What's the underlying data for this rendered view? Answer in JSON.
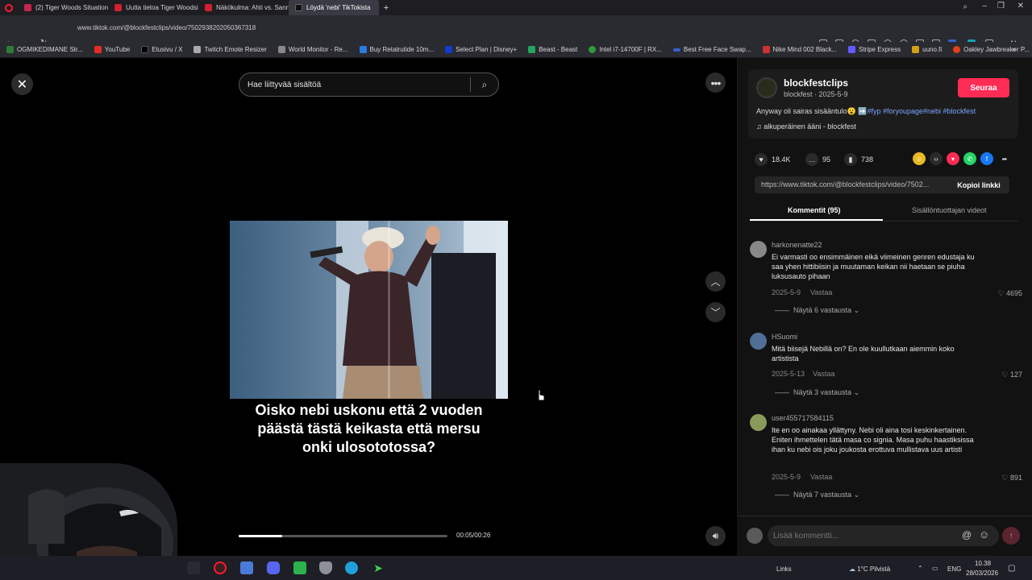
{
  "browser": {
    "tabs": [
      {
        "title": "(2) Tiger Woods Situation",
        "color": "#c7254e"
      },
      {
        "title": "Uutta tietoa Tiger Woodsi",
        "color": "#d3202e"
      },
      {
        "title": "Näkökulma: Ahti vs. Sann",
        "color": "#d3202e"
      },
      {
        "title": "Löydä 'nebi' TikTokista",
        "color": "#222"
      }
    ],
    "url": "www.tiktok.com/@blockfestclips/video/7502938202050367318",
    "bookmarks": [
      {
        "label": "OGMIKEDIMANE Str...",
        "color": "#2e7d32"
      },
      {
        "label": "YouTube",
        "color": "#e52d27"
      },
      {
        "label": "Etusivu / X",
        "color": "#000"
      },
      {
        "label": "Twitch Emote Resizer",
        "color": "#aaa"
      },
      {
        "label": "World Monitor - Re...",
        "color": "#888"
      },
      {
        "label": "Buy Retatrutide 10m...",
        "color": "#2a7ae2"
      },
      {
        "label": "Select Plan | Disney+",
        "color": "#113ccf"
      },
      {
        "label": "Beast - Beast",
        "color": "#25a55f"
      },
      {
        "label": "Intel i7-14700F | RX...",
        "color": "#2e9a3b"
      },
      {
        "label": "Best Free Face Swap...",
        "color": "#3a5fcf"
      },
      {
        "label": "Nike Mind 002 Black...",
        "color": "#c33"
      },
      {
        "label": "Stripe Express",
        "color": "#635bff"
      },
      {
        "label": "uuno.fi",
        "color": "#d4a017"
      },
      {
        "label": "Oakley Jawbreaker P...",
        "color": "#e2411a"
      }
    ]
  },
  "search": {
    "placeholder": "Hae liittyvää sisältöä"
  },
  "video": {
    "caption": "Oisko nebi uskonu että 2 vuoden päästä tästä keikasta että mersu onki ulosototossa?",
    "time": "00:05/00:26",
    "progress": 0.21
  },
  "author": {
    "name": "blockfestclips",
    "meta": "blockfest · 2025-5-9",
    "follow_label": "Seuraa"
  },
  "post": {
    "desc_text": "Anyway oli sairas sisääntulo😮 ➡️",
    "desc_tags": "#fyp #foryoupage#nebi #blockfest",
    "sound": "♫  alkuperäinen ääni - blockfest",
    "likes": "18.4K",
    "comments": "95",
    "saves": "738",
    "link": "https://www.tiktok.com/@blockfestclips/video/7502...",
    "copy_label": "Kopioi linkki"
  },
  "tabs": {
    "comments": "Kommentit (95)",
    "creator_videos": "Sisällöntuottajan videot"
  },
  "comments": [
    {
      "user": "harkonenatte22",
      "text": "Ei varmasti oo ensimmäinen eikä viimeinen genren edustaja ku saa yhen hittibiisin ja muutaman keikan nii haetaan se piuha luksusauto pihaan",
      "date": "2025-5-9",
      "reply": "Vastaa",
      "likes": "4695",
      "more": "Näytä 6 vastausta",
      "avatar": "#888"
    },
    {
      "user": "HSuomi",
      "text": "Mitä biisejä Nebillä on? En ole kuullutkaan aiemmin koko artistista",
      "date": "2025-5-13",
      "reply": "Vastaa",
      "likes": "127",
      "more": "Näytä 3 vastausta",
      "avatar": "#4f6f96"
    },
    {
      "user": "user455717584115",
      "text": "Ite en oo ainakaa yllättyny. Nebi oli aina tosi keskinkertainen. Eniten ihmettelen tätä masa co signia. Masa puhu haastiksissa ihan ku nebi ois joku joukosta erottuva mullistava uus artisti",
      "date": "2025-5-9",
      "reply": "Vastaa",
      "likes": "891",
      "more": "Näytä 7 vastausta",
      "avatar": "#8a9a5a"
    }
  ],
  "comment_input": {
    "placeholder": "Lisää kommentti..."
  },
  "taskbar": {
    "links": "Links",
    "weather": "1°C  Pilvistä",
    "lang": "ENG",
    "time": "10.38",
    "date": "28/03/2026"
  }
}
